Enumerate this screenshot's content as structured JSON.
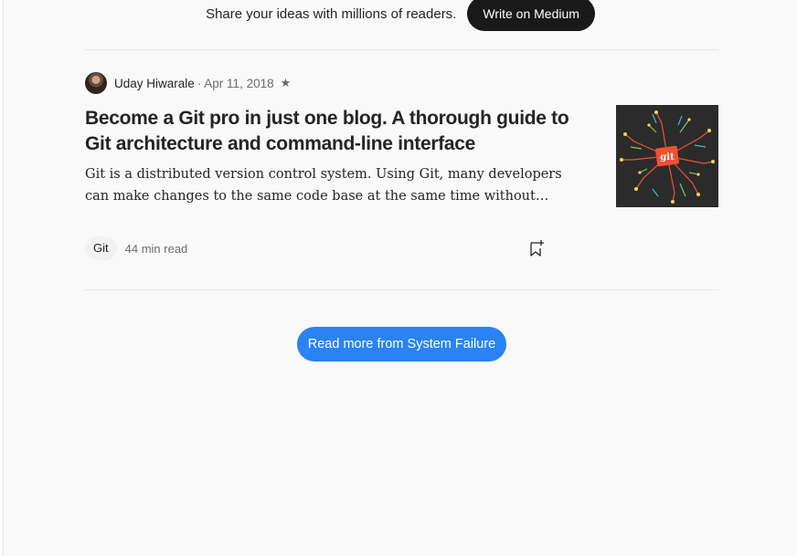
{
  "cta": {
    "text": "Share your ideas with millions of readers.",
    "button_label": "Write on Medium"
  },
  "post": {
    "author": "Uday Hiwarale",
    "separator": "·",
    "date": "Apr 11, 2018",
    "member_icon": "star-icon",
    "title": "Become a Git pro in just one blog. A thorough guide to Git architecture and command-line interface",
    "excerpt": "Git is a distributed version control system. Using Git, many developers can make changes to the same code base at the same time without running into conflicts.",
    "thumbnail_text": "git",
    "tag": "Git",
    "read_time": "44 min read"
  },
  "read_more_label": "Read more from System Failure",
  "colors": {
    "accent": "#2a83f3",
    "dark_button": "#191919",
    "text": "#242424",
    "muted": "#6b6b6b",
    "git_orange": "#f05133"
  }
}
